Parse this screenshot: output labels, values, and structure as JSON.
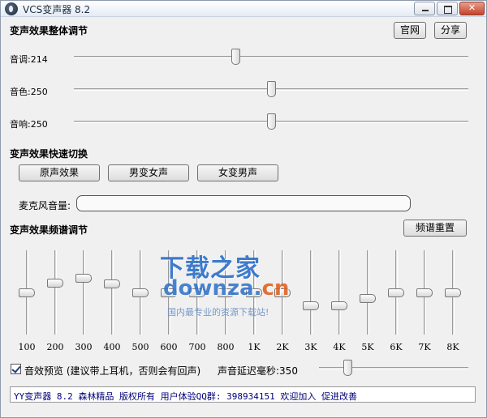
{
  "window": {
    "title": "VCS变声器 8.2"
  },
  "header": {
    "section_overall": "变声效果整体调节",
    "official_site_button": "官网",
    "share_button": "分享"
  },
  "sliders": {
    "pitch": {
      "label": "音调:214",
      "value": 214,
      "fraction": 0.41
    },
    "timbre": {
      "label": "音色:250",
      "value": 250,
      "fraction": 0.5
    },
    "echo": {
      "label": "音响:250",
      "value": 250,
      "fraction": 0.5
    }
  },
  "quick_switch": {
    "title": "变声效果快速切换",
    "buttons": [
      "原声效果",
      "男变女声",
      "女变男声"
    ]
  },
  "mic": {
    "label": "麦克风音量:",
    "level": 0
  },
  "equalizer": {
    "title": "变声效果频谱调节",
    "reset_button": "频谱重置",
    "bands": [
      {
        "label": "100",
        "level": 0.5
      },
      {
        "label": "200",
        "level": 0.62
      },
      {
        "label": "300",
        "level": 0.67
      },
      {
        "label": "400",
        "level": 0.61
      },
      {
        "label": "500",
        "level": 0.5
      },
      {
        "label": "600",
        "level": 0.5
      },
      {
        "label": "700",
        "level": 0.5
      },
      {
        "label": "800",
        "level": 0.5
      },
      {
        "label": "1K",
        "level": 0.5
      },
      {
        "label": "2K",
        "level": 0.5
      },
      {
        "label": "3K",
        "level": 0.35
      },
      {
        "label": "4K",
        "level": 0.35
      },
      {
        "label": "5K",
        "level": 0.43
      },
      {
        "label": "6K",
        "level": 0.5
      },
      {
        "label": "7K",
        "level": 0.5
      },
      {
        "label": "8K",
        "level": 0.5
      }
    ]
  },
  "preview": {
    "checked": true,
    "label": "音效预览 (建议带上耳机，否则会有回声)"
  },
  "delay": {
    "label": "声音延迟毫秒:350",
    "value": 350,
    "fraction": 0.19
  },
  "status": {
    "text": "YY变声器 8.2 森林精品 版权所有 用户体验QQ群: 398934151 欢迎加入 促进改善"
  },
  "watermark": {
    "brand": "下载之家",
    "domain_main": "downza.",
    "domain_tld": "cn",
    "slogan": "国内最专业的资源下载站!"
  },
  "colors": {
    "accent": "#2a6fc9",
    "status_text": "#00007a"
  }
}
